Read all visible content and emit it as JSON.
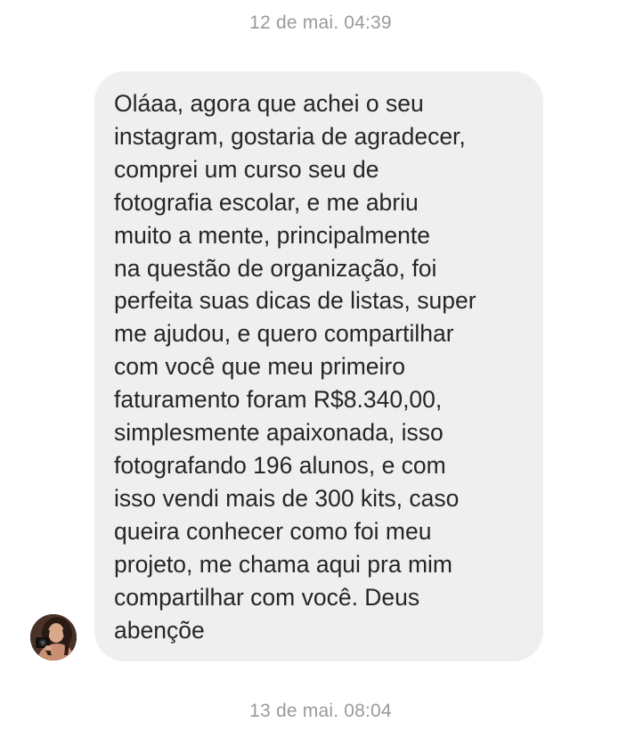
{
  "timestamps": {
    "top": "12 de mai. 04:39",
    "bottom": "13 de mai. 08:04"
  },
  "message": {
    "lines": [
      "Oláaa, agora que achei o seu",
      "instagram, gostaria de agradecer,",
      "comprei um curso seu de",
      "fotografia escolar, e me abriu",
      "muito a mente, principalmente",
      "na questão de organização, foi",
      "perfeita suas dicas de listas, super",
      "me ajudou, e quero compartilhar",
      "com você que meu primeiro",
      "faturamento foram R$8.340,00,",
      "simplesmente apaixonada, isso",
      "fotografando 196 alunos, e com",
      "isso vendi mais de 300 kits, caso",
      "queira conhecer como foi meu",
      "projeto, me chama aqui pra mim",
      "compartilhar com você. Deus",
      "abençõe"
    ]
  },
  "sender": {
    "avatar_icon": "profile-photo"
  },
  "colors": {
    "bubble_background": "#efefef",
    "message_text": "#262626",
    "timestamp_text": "#9a9a9a"
  }
}
